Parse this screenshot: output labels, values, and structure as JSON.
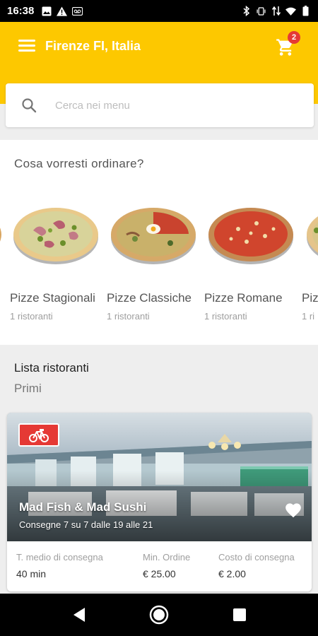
{
  "status_bar": {
    "time": "16:38",
    "left_icons": [
      "image-icon",
      "alert-icon",
      "voicemail-icon"
    ],
    "right_icons": [
      "bluetooth-icon",
      "vibrate-icon",
      "data-arrows-icon",
      "wifi-icon",
      "battery-icon"
    ]
  },
  "app_bar": {
    "location": "Firenze FI, Italia",
    "cart_count": "2",
    "color": "#fdc800"
  },
  "search": {
    "placeholder": "Cerca nei menu"
  },
  "categories": {
    "title": "Cosa vorresti ordinare?",
    "items": [
      {
        "name": "Pizze Stagionali",
        "count": "1 ristoranti"
      },
      {
        "name": "Pizze Classiche",
        "count": "1 ristoranti"
      },
      {
        "name": "Pizze Romane",
        "count": "1 ristoranti"
      },
      {
        "name": "Pizze",
        "count": "1 ri"
      }
    ]
  },
  "restaurants": {
    "title": "Lista ristoranti",
    "subtitle": "Primi",
    "items": [
      {
        "name": "Mad Fish & Mad Sushi",
        "hours": "Consegne 7 su 7 dalle 19 alle 21",
        "avg_delivery_label": "T. medio di consegna",
        "avg_delivery_value": "40 min",
        "min_order_label": "Min. Ordine",
        "min_order_value": "€ 25.00",
        "delivery_cost_label": "Costo di consegna",
        "delivery_cost_value": "€ 2.00"
      }
    ]
  },
  "colors": {
    "accent": "#fdc800",
    "badge": "#e53935"
  }
}
